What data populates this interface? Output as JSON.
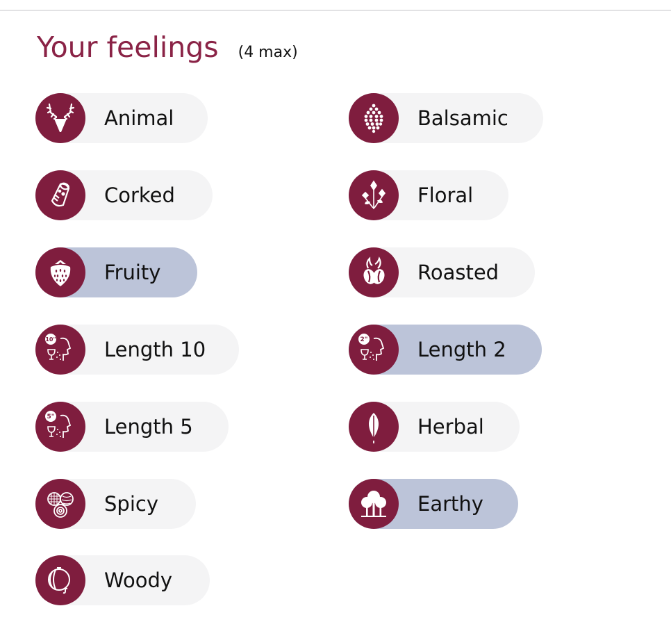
{
  "header": {
    "title": "Your feelings",
    "subtitle": "(4 max)"
  },
  "colors": {
    "accent": "#7f1d3e",
    "title": "#8a2346",
    "chip_default": "#f4f4f5",
    "chip_selected": "#bcc4d9"
  },
  "feelings": [
    {
      "label": "Animal",
      "icon": "deer-head-icon",
      "selected": false
    },
    {
      "label": "Balsamic",
      "icon": "pine-cone-icon",
      "selected": false
    },
    {
      "label": "Corked",
      "icon": "cork-icon",
      "selected": false
    },
    {
      "label": "Floral",
      "icon": "flowers-icon",
      "selected": false
    },
    {
      "label": "Fruity",
      "icon": "strawberry-icon",
      "selected": true
    },
    {
      "label": "Roasted",
      "icon": "coffee-bean-icon",
      "selected": false
    },
    {
      "label": "Length 10",
      "icon": "length-10-seconds-icon",
      "icon_badge": "10\"",
      "selected": false
    },
    {
      "label": "Length 2",
      "icon": "length-2-seconds-icon",
      "icon_badge": "2\"",
      "selected": true
    },
    {
      "label": "Length 5",
      "icon": "length-5-seconds-icon",
      "icon_badge": "5\"",
      "selected": false
    },
    {
      "label": "Herbal",
      "icon": "leaf-icon",
      "selected": false
    },
    {
      "label": "Spicy",
      "icon": "spices-icon",
      "selected": false
    },
    {
      "label": "Earthy",
      "icon": "trees-icon",
      "selected": true
    },
    {
      "label": "Woody",
      "icon": "barrel-icon",
      "selected": false
    }
  ]
}
